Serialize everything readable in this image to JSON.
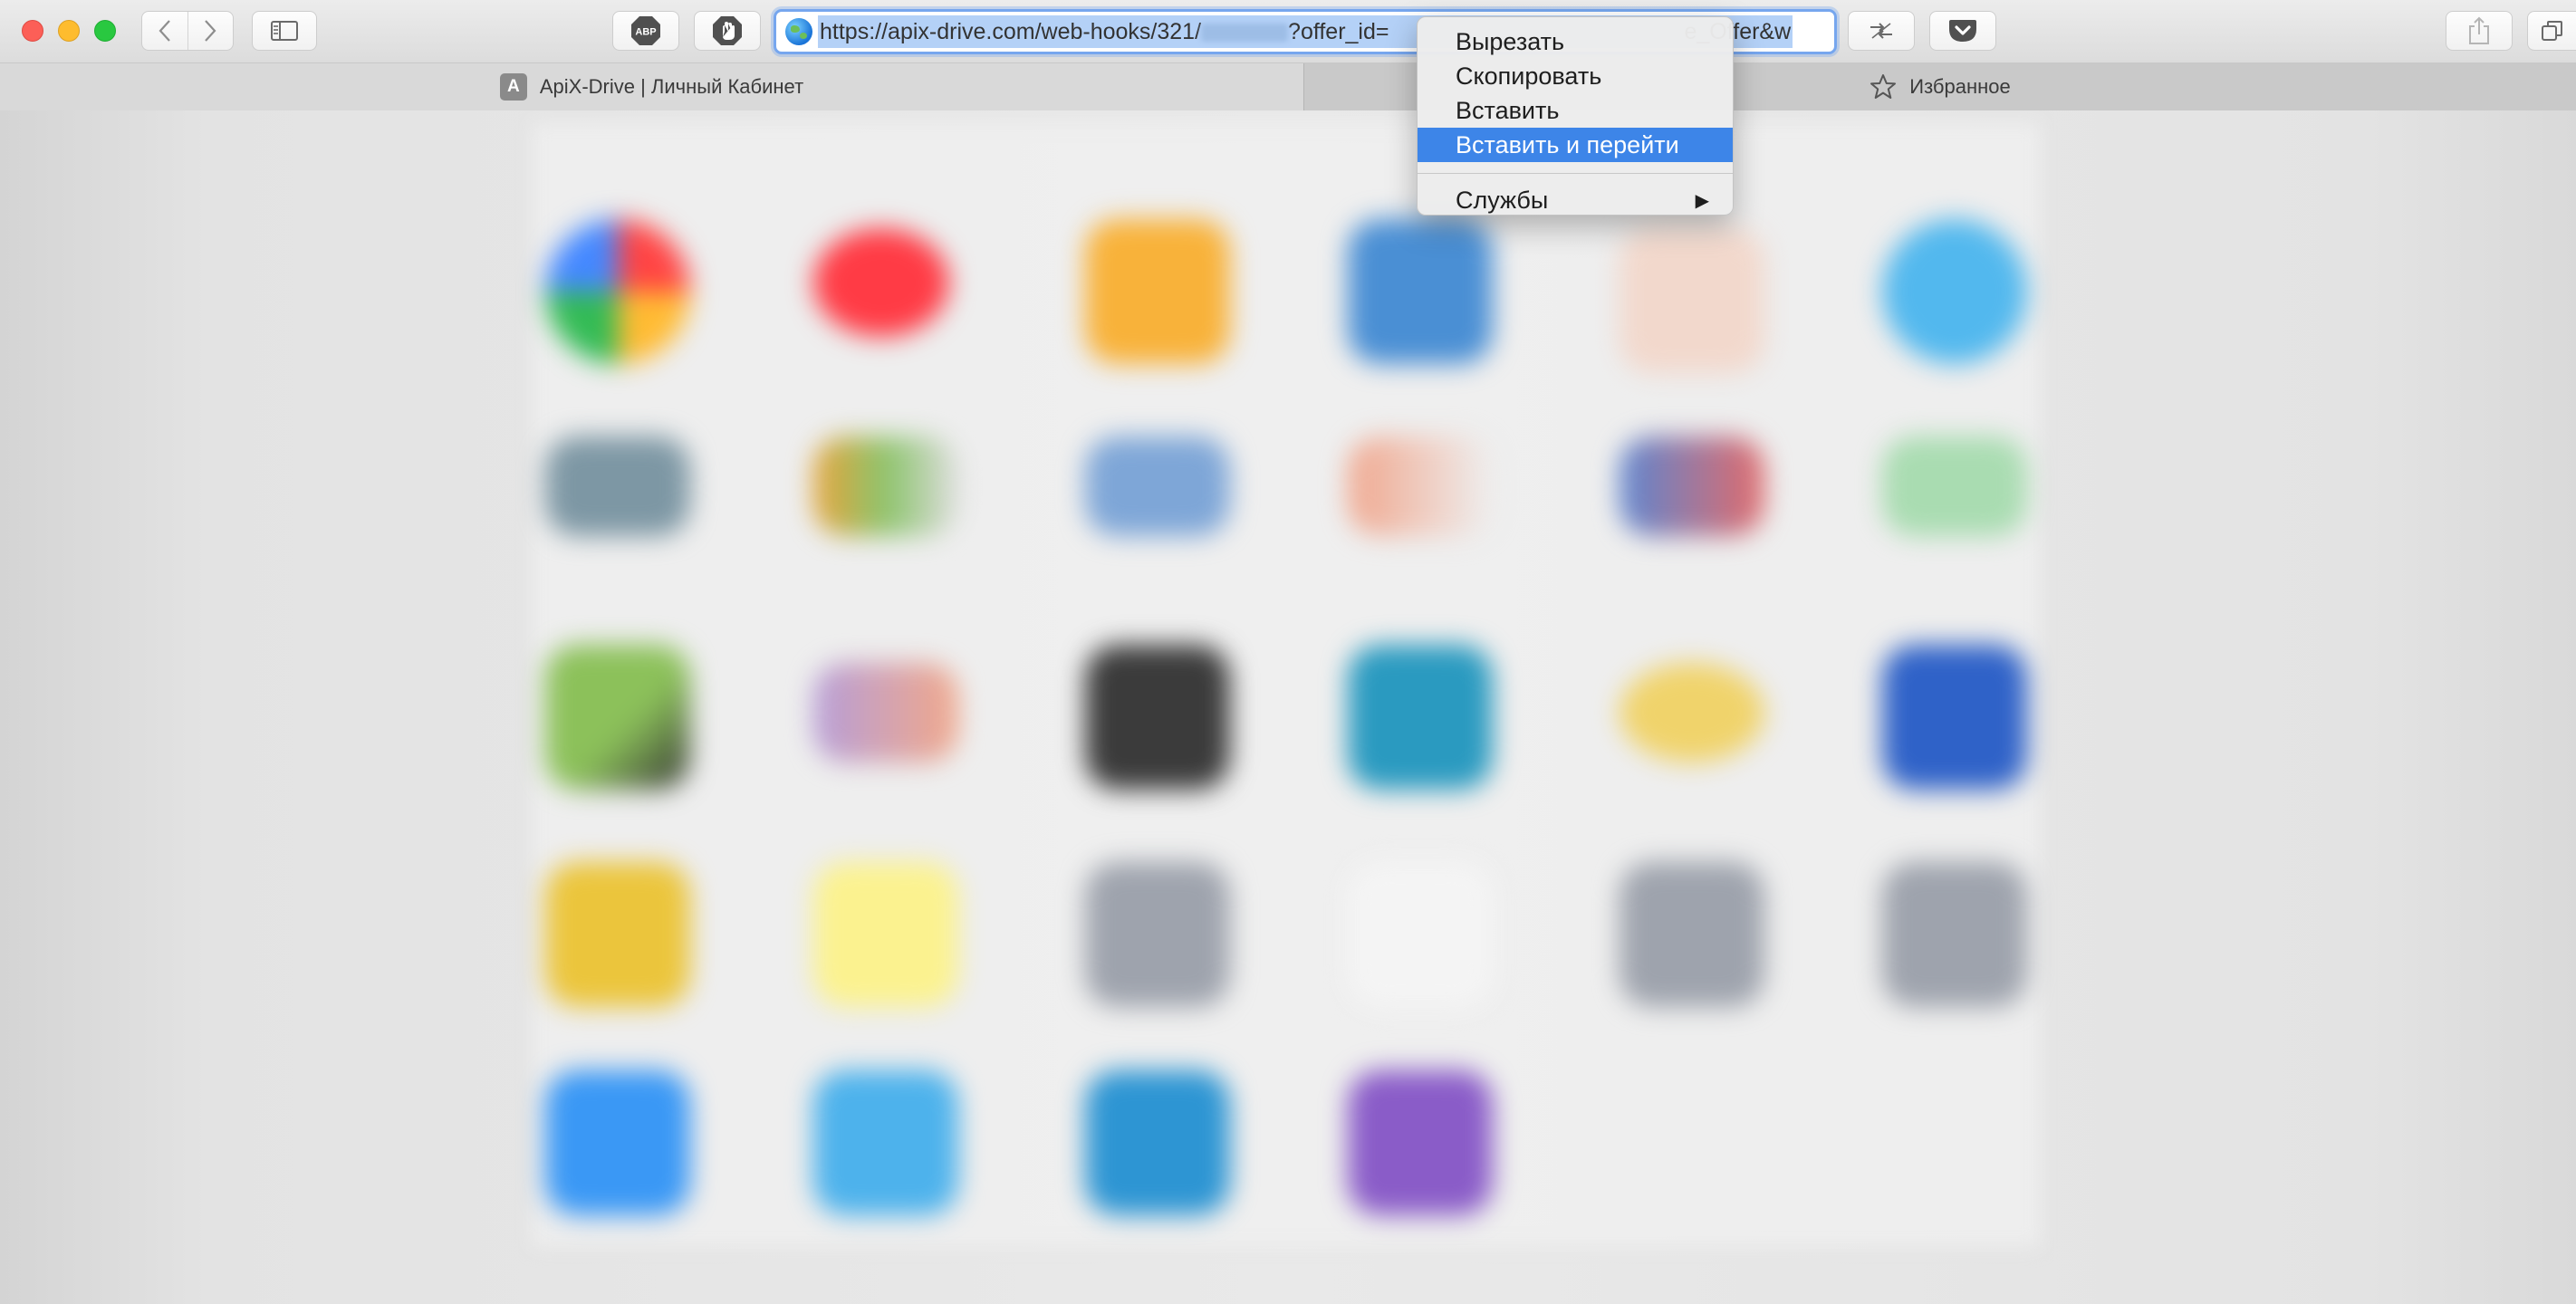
{
  "window": {
    "buttons": {
      "close": "close",
      "minimize": "minimize",
      "zoom": "zoom"
    }
  },
  "toolbar": {
    "adblock_label": "ABP",
    "address_bar": {
      "url_visible_start": "https://apix-drive.com/web-hooks/321/",
      "url_visible_mid": "?offer_id=",
      "url_visible_end": "e_Offer&w"
    }
  },
  "tabs": [
    {
      "favicon_letter": "A",
      "label": "ApiX-Drive | Личный Кабинет"
    },
    {
      "label": "Избранное"
    }
  ],
  "context_menu": {
    "items": [
      {
        "label": "Вырезать"
      },
      {
        "label": "Скопировать"
      },
      {
        "label": "Вставить"
      },
      {
        "label": "Вставить и перейти",
        "highlighted": true
      }
    ],
    "services": {
      "label": "Службы",
      "arrow": "▶"
    }
  },
  "colors": {
    "selection_highlight": "#3d85e8",
    "address_focus_ring": "#76a6ee",
    "url_selection": "#b4d1f7"
  }
}
